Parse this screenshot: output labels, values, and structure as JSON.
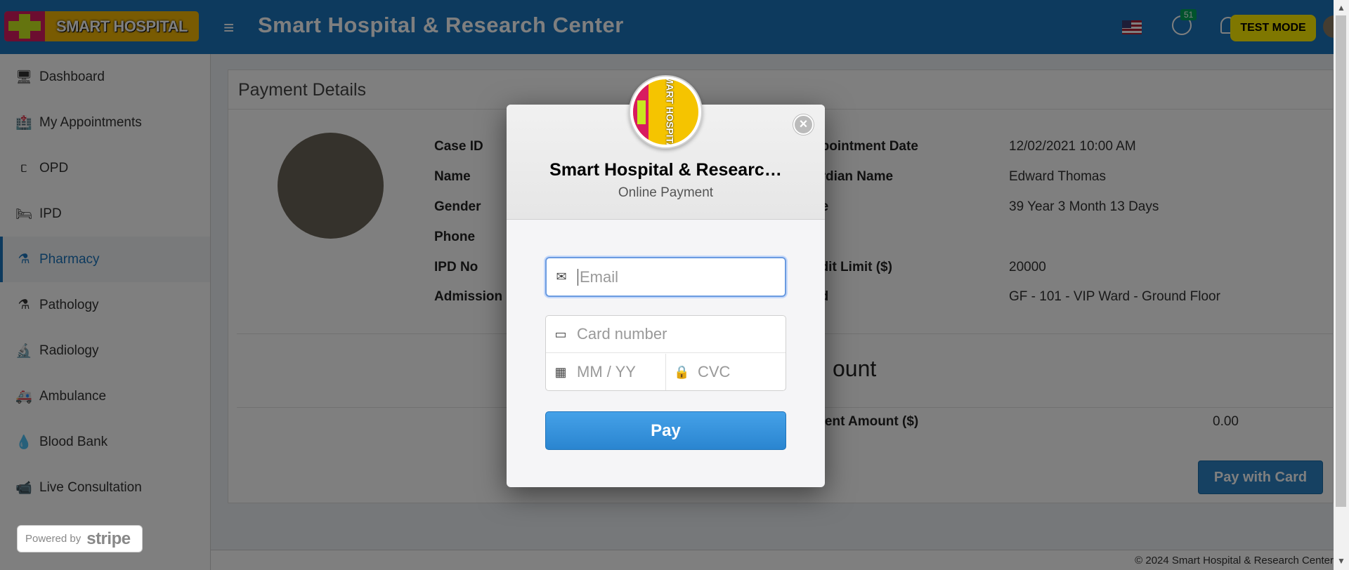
{
  "header": {
    "logo_text": "SMART HOSPITAL",
    "menu_icon": "hamburger-icon",
    "title": "Smart Hospital & Research Center",
    "whatsapp_badge": "51",
    "test_mode": "TEST MODE",
    "brand_color": "#1b75bc"
  },
  "sidebar": {
    "items": [
      {
        "label": "Dashboard",
        "icon": "monitor-icon"
      },
      {
        "label": "My Appointments",
        "icon": "hospital-icon"
      },
      {
        "label": "OPD",
        "icon": "stethoscope-icon"
      },
      {
        "label": "IPD",
        "icon": "bed-icon"
      },
      {
        "label": "Pharmacy",
        "icon": "mortar-pestle-icon",
        "active": true
      },
      {
        "label": "Pathology",
        "icon": "flask-icon"
      },
      {
        "label": "Radiology",
        "icon": "microscope-icon"
      },
      {
        "label": "Ambulance",
        "icon": "ambulance-icon"
      },
      {
        "label": "Blood Bank",
        "icon": "tint-icon"
      },
      {
        "label": "Live Consultation",
        "icon": "video-icon"
      }
    ],
    "powered_by": "Powered by",
    "stripe": "stripe"
  },
  "panel": {
    "title": "Payment Details",
    "left_labels": [
      "Case ID",
      "Name",
      "Gender",
      "Phone",
      "IPD No",
      "Admission D"
    ],
    "right_labels": [
      "ppointment Date",
      "ardian Name",
      "ge",
      "edit Limit ($)",
      "ed"
    ],
    "right_values": [
      "12/02/2021 10:00 AM",
      "Edward Thomas",
      "39 Year 3 Month 13 Days",
      "20000",
      "GF - 101 - VIP Ward - Ground Floor"
    ],
    "amount_heading": "ount",
    "payment_amount_label": "ment Amount ($)",
    "payment_amount_value": "0.00",
    "pay_with_card": "Pay with Card"
  },
  "footer": {
    "copyright": "© 2024 Smart Hospital & Research Center"
  },
  "modal": {
    "logo_text": "SMART HOSPITAL",
    "title": "Smart Hospital & Researc…",
    "subtitle": "Online Payment",
    "email_placeholder": "Email",
    "card_placeholder": "Card number",
    "expiry_placeholder": "MM / YY",
    "cvc_placeholder": "CVC",
    "pay_label": "Pay",
    "close_symbol": "×"
  }
}
